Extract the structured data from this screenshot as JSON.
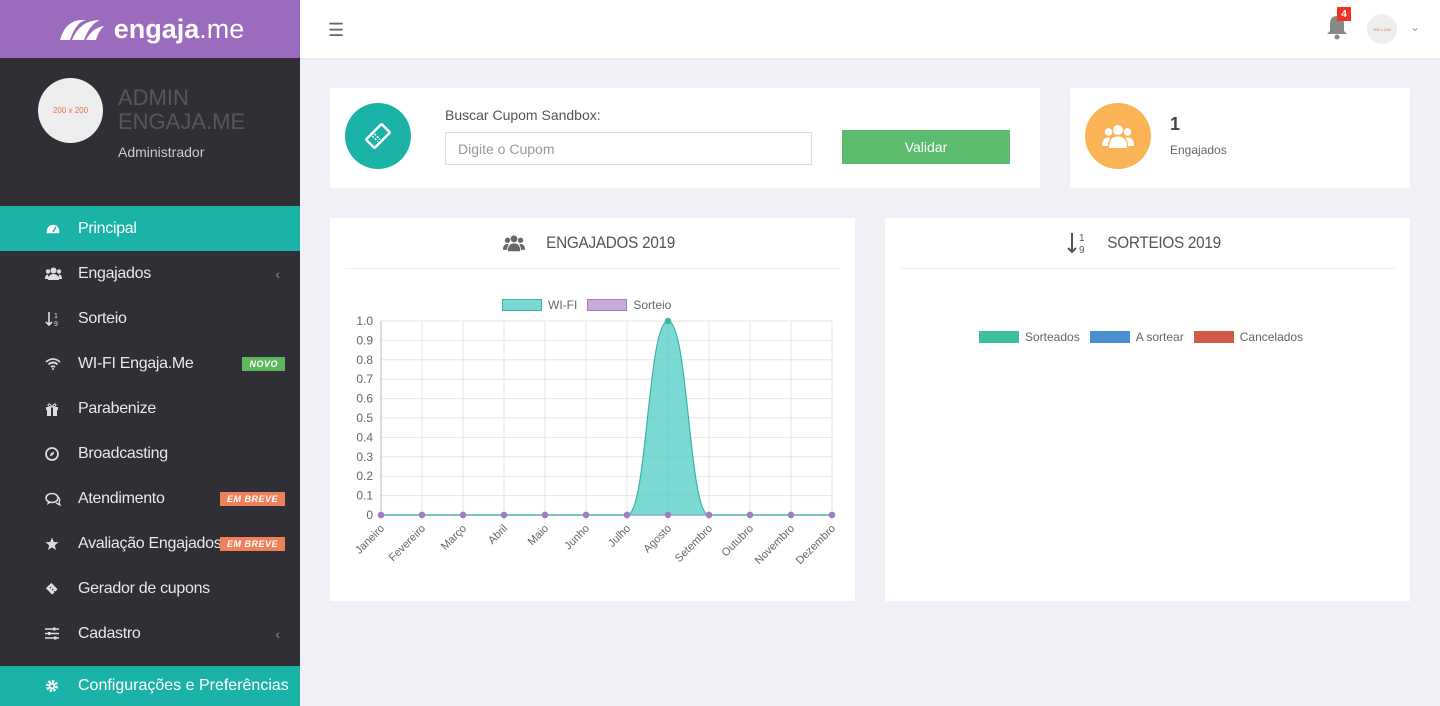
{
  "brand": {
    "name_bold": "engaja",
    "name_light": ".me"
  },
  "profile": {
    "avatar_text": "200 x 200",
    "name": "ADMIN ENGAJA.ME",
    "role": "Administrador"
  },
  "nav": [
    {
      "label": "Principal",
      "icon": "dashboard-icon",
      "active": true
    },
    {
      "label": "Engajados",
      "icon": "users-icon",
      "chevron": true
    },
    {
      "label": "Sorteio",
      "icon": "sort-numeric-icon"
    },
    {
      "label": "WI-FI Engaja.Me",
      "icon": "wifi-icon",
      "badge": "NOVO"
    },
    {
      "label": "Parabenize",
      "icon": "gift-icon"
    },
    {
      "label": "Broadcasting",
      "icon": "compass-icon"
    },
    {
      "label": "Atendimento",
      "icon": "comments-icon",
      "badge": "EM BREVE"
    },
    {
      "label": "Avaliação Engajados",
      "icon": "star-icon",
      "badge": "EM BREVE"
    },
    {
      "label": "Gerador de cupons",
      "icon": "ticket-icon"
    },
    {
      "label": "Cadastro",
      "icon": "sliders-icon",
      "chevron": true
    }
  ],
  "config_item": {
    "label": "Configurações e Preferências",
    "icon": "gear-icon"
  },
  "topbar": {
    "notification_count": "4",
    "user_avatar_text": "200 x 200"
  },
  "coupon": {
    "label": "Buscar Cupom Sandbox:",
    "placeholder": "Digite o Cupom",
    "button": "Validar"
  },
  "engajados_stat": {
    "count": "1",
    "label": "Engajados"
  },
  "chart_engajados": {
    "title": "ENGAJADOS 2019"
  },
  "chart_sorteios": {
    "title": "SORTEIOS 2019"
  },
  "colors": {
    "teal": "#1bb3a7",
    "purple": "#9b6bbd",
    "orange": "#fbb455",
    "green": "#5cbc6e"
  },
  "chart_data": [
    {
      "type": "area",
      "title": "ENGAJADOS 2019",
      "categories": [
        "Janeiro",
        "Fevereiro",
        "Março",
        "Abril",
        "Maio",
        "Junho",
        "Julho",
        "Agosto",
        "Setembro",
        "Outubro",
        "Novembro",
        "Dezembro"
      ],
      "series": [
        {
          "name": "WI-FI",
          "color": "#4ecdc4",
          "values": [
            0,
            0,
            0,
            0,
            0,
            0,
            0,
            1,
            0,
            0,
            0,
            0
          ]
        },
        {
          "name": "Sorteio",
          "color": "#b48fcf",
          "values": [
            0,
            0,
            0,
            0,
            0,
            0,
            0,
            0,
            0,
            0,
            0,
            0
          ]
        }
      ],
      "ylim": [
        0,
        1
      ],
      "yticks": [
        "0",
        "0.1",
        "0.2",
        "0.3",
        "0.4",
        "0.5",
        "0.6",
        "0.7",
        "0.8",
        "0.9",
        "1.0"
      ],
      "grid": true,
      "legend": "top"
    },
    {
      "type": "pie",
      "title": "SORTEIOS 2019",
      "series": [
        {
          "name": "Sorteados",
          "color": "#3bbf9e",
          "values": []
        },
        {
          "name": "A sortear",
          "color": "#4a90d0",
          "values": []
        },
        {
          "name": "Cancelados",
          "color": "#d05a4a",
          "values": []
        }
      ],
      "legend": "top"
    }
  ]
}
